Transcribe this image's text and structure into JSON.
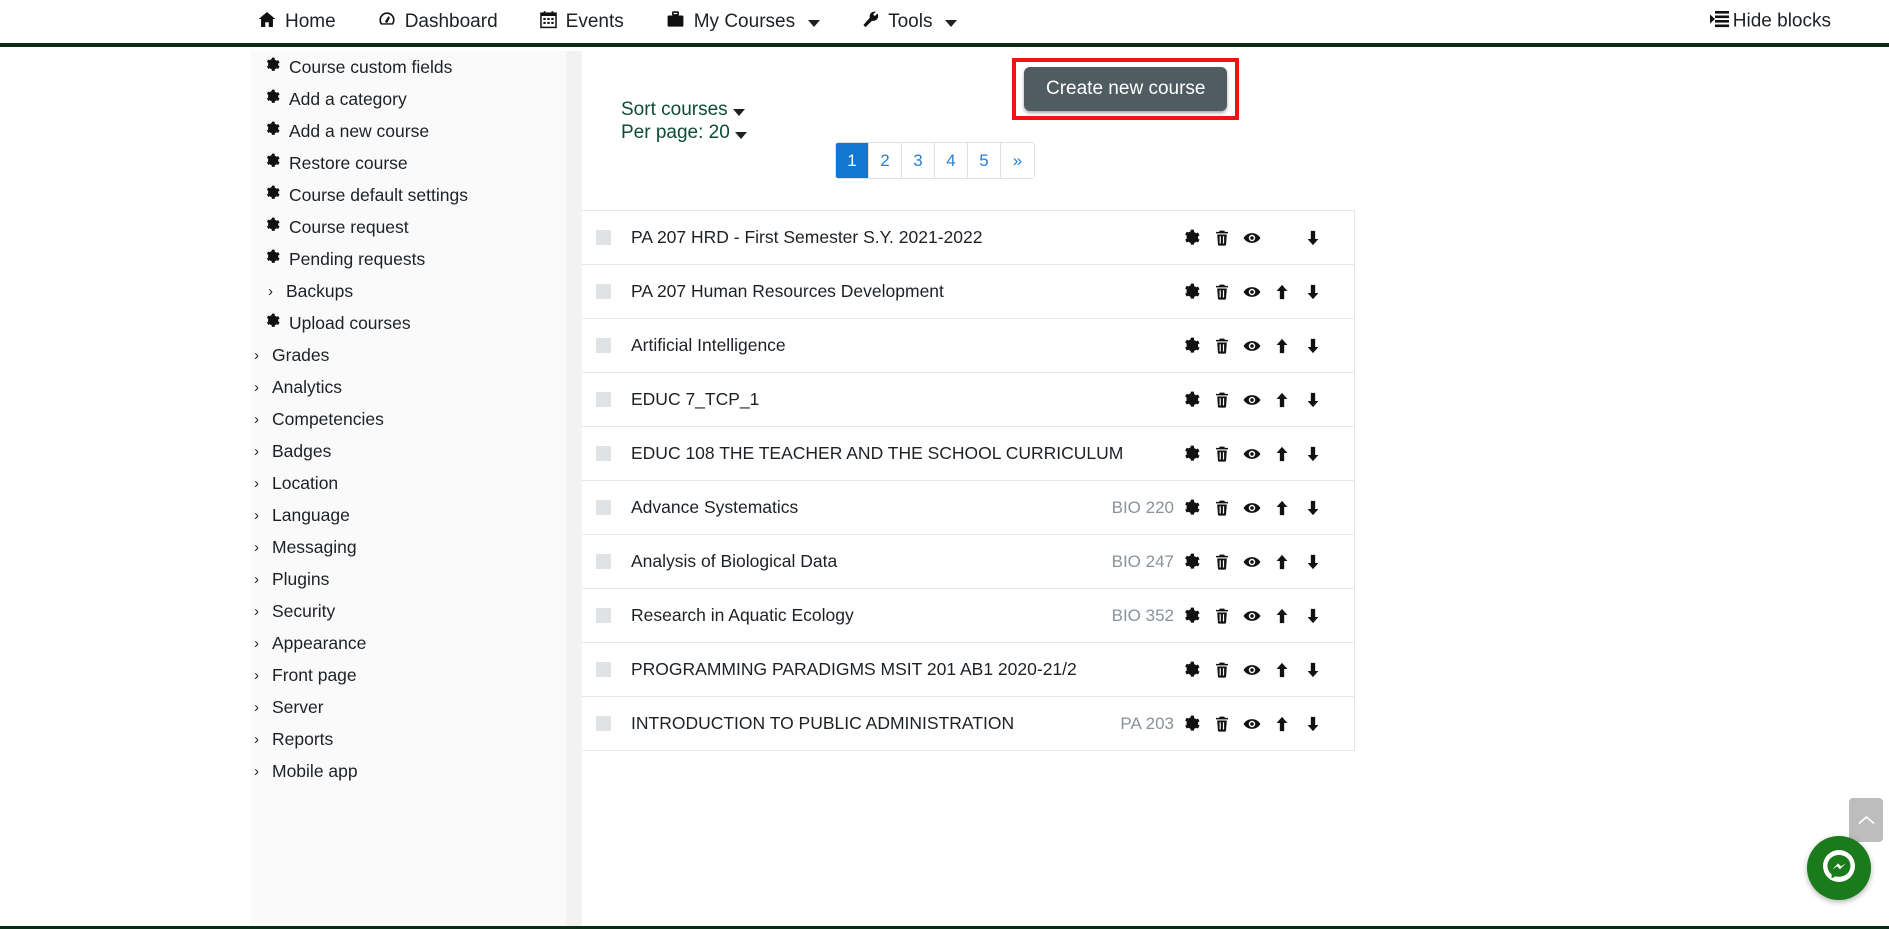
{
  "navbar": {
    "items": [
      {
        "label": "Home",
        "icon": "home-icon",
        "glyph": "⌂",
        "caret": false
      },
      {
        "label": "Dashboard",
        "icon": "dashboard-icon",
        "glyph": "◔",
        "caret": false
      },
      {
        "label": "Events",
        "icon": "calendar-icon",
        "glyph": "Ὄ5",
        "caret": false
      },
      {
        "label": "My Courses",
        "icon": "briefcase-icon",
        "glyph": "▬",
        "caret": true
      },
      {
        "label": "Tools",
        "icon": "wrench-icon",
        "glyph": "⚒",
        "caret": true
      }
    ],
    "hide_blocks": {
      "label": "Hide blocks",
      "icon": "hide-blocks-icon"
    }
  },
  "sidebar": {
    "items": [
      {
        "label": "Course custom fields",
        "icon": "gear-icon",
        "level": 3,
        "expandable": false
      },
      {
        "label": "Add a category",
        "icon": "gear-icon",
        "level": 3,
        "expandable": false
      },
      {
        "label": "Add a new course",
        "icon": "gear-icon",
        "level": 3,
        "expandable": false
      },
      {
        "label": "Restore course",
        "icon": "gear-icon",
        "level": 3,
        "expandable": false
      },
      {
        "label": "Course default settings",
        "icon": "gear-icon",
        "level": 3,
        "expandable": false
      },
      {
        "label": "Course request",
        "icon": "gear-icon",
        "level": 3,
        "expandable": false
      },
      {
        "label": "Pending requests",
        "icon": "gear-icon",
        "level": 3,
        "expandable": false
      },
      {
        "label": "Backups",
        "icon": "chevron-right-icon",
        "level": 3,
        "expandable": true
      },
      {
        "label": "Upload courses",
        "icon": "gear-icon",
        "level": 3,
        "expandable": false
      },
      {
        "label": "Grades",
        "icon": "chevron-right-icon",
        "level": 2,
        "expandable": true
      },
      {
        "label": "Analytics",
        "icon": "chevron-right-icon",
        "level": 2,
        "expandable": true
      },
      {
        "label": "Competencies",
        "icon": "chevron-right-icon",
        "level": 2,
        "expandable": true
      },
      {
        "label": "Badges",
        "icon": "chevron-right-icon",
        "level": 2,
        "expandable": true
      },
      {
        "label": "Location",
        "icon": "chevron-right-icon",
        "level": 2,
        "expandable": true
      },
      {
        "label": "Language",
        "icon": "chevron-right-icon",
        "level": 2,
        "expandable": true
      },
      {
        "label": "Messaging",
        "icon": "chevron-right-icon",
        "level": 2,
        "expandable": true
      },
      {
        "label": "Plugins",
        "icon": "chevron-right-icon",
        "level": 2,
        "expandable": true
      },
      {
        "label": "Security",
        "icon": "chevron-right-icon",
        "level": 2,
        "expandable": true
      },
      {
        "label": "Appearance",
        "icon": "chevron-right-icon",
        "level": 2,
        "expandable": true
      },
      {
        "label": "Front page",
        "icon": "chevron-right-icon",
        "level": 2,
        "expandable": true
      },
      {
        "label": "Server",
        "icon": "chevron-right-icon",
        "level": 2,
        "expandable": true
      },
      {
        "label": "Reports",
        "icon": "chevron-right-icon",
        "level": 2,
        "expandable": true
      },
      {
        "label": "Mobile app",
        "icon": "chevron-right-icon",
        "level": 2,
        "expandable": true
      }
    ]
  },
  "main": {
    "create_button": {
      "label": "Create new course",
      "highlight_color": "#f31212",
      "background": "#4f5d63"
    },
    "sort_courses": {
      "label": "Sort courses"
    },
    "per_page": {
      "label": "Per page: 20",
      "value": "20"
    },
    "pagination": {
      "pages": [
        "1",
        "2",
        "3",
        "4",
        "5"
      ],
      "next_label": "»",
      "active": "1",
      "active_color": "#1177d1"
    },
    "courses": [
      {
        "name": "PA 207 HRD - First Semester S.Y. 2021-2022",
        "code": "",
        "actions": [
          "gear-icon",
          "trash-icon",
          "eye-icon",
          "arrow-down-icon"
        ]
      },
      {
        "name": "PA 207 Human Resources Development",
        "code": "",
        "actions": [
          "gear-icon",
          "trash-icon",
          "eye-icon",
          "arrow-up-icon",
          "arrow-down-icon"
        ]
      },
      {
        "name": "Artificial Intelligence",
        "code": "",
        "actions": [
          "gear-icon",
          "trash-icon",
          "eye-icon",
          "arrow-up-icon",
          "arrow-down-icon"
        ]
      },
      {
        "name": "EDUC 7_TCP_1",
        "code": "",
        "actions": [
          "gear-icon",
          "trash-icon",
          "eye-icon",
          "arrow-up-icon",
          "arrow-down-icon"
        ]
      },
      {
        "name": "EDUC 108 THE TEACHER AND THE SCHOOL CURRICULUM",
        "code": "",
        "actions": [
          "gear-icon",
          "trash-icon",
          "eye-icon",
          "arrow-up-icon",
          "arrow-down-icon"
        ]
      },
      {
        "name": "Advance Systematics",
        "code": "BIO 220",
        "actions": [
          "gear-icon",
          "trash-icon",
          "eye-icon",
          "arrow-up-icon",
          "arrow-down-icon"
        ]
      },
      {
        "name": "Analysis of Biological Data",
        "code": "BIO 247",
        "actions": [
          "gear-icon",
          "trash-icon",
          "eye-icon",
          "arrow-up-icon",
          "arrow-down-icon"
        ]
      },
      {
        "name": "Research in Aquatic Ecology",
        "code": "BIO 352",
        "actions": [
          "gear-icon",
          "trash-icon",
          "eye-icon",
          "arrow-up-icon",
          "arrow-down-icon"
        ]
      },
      {
        "name": "PROGRAMMING PARADIGMS MSIT 201 AB1 2020-21/2",
        "code": "",
        "actions": [
          "gear-icon",
          "trash-icon",
          "eye-icon",
          "arrow-up-icon",
          "arrow-down-icon"
        ]
      },
      {
        "name": "INTRODUCTION TO PUBLIC ADMINISTRATION",
        "code": "PA 203",
        "actions": [
          "gear-icon",
          "trash-icon",
          "eye-icon",
          "arrow-up-icon",
          "arrow-down-icon"
        ]
      }
    ]
  },
  "floating": {
    "scroll_top": {
      "icon": "chevron-up-icon",
      "color": "#bdbdbd"
    },
    "messenger": {
      "icon": "messenger-icon",
      "color": "#1b7a1b"
    }
  }
}
